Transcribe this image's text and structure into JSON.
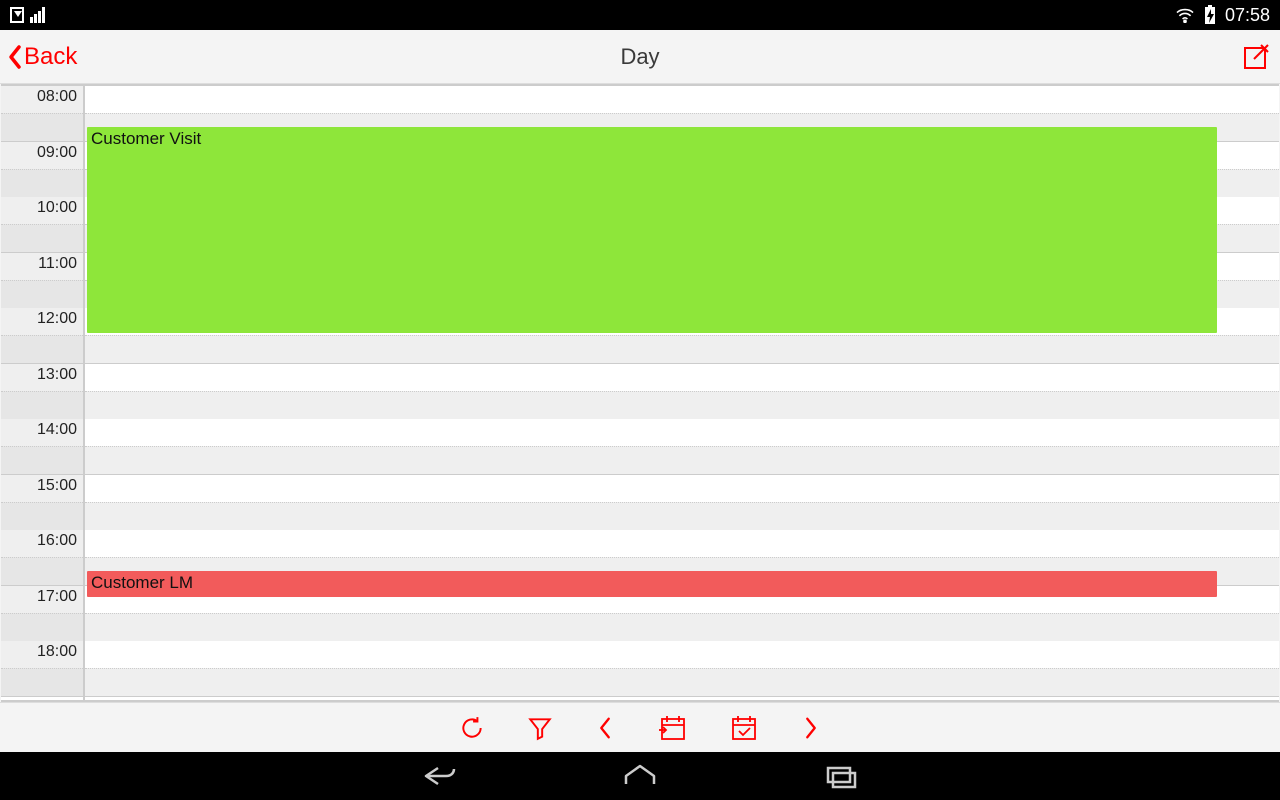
{
  "status": {
    "time": "07:58"
  },
  "header": {
    "back_label": "Back",
    "title": "Day"
  },
  "hours": [
    "08:00",
    "09:00",
    "10:00",
    "11:00",
    "12:00",
    "13:00",
    "14:00",
    "15:00",
    "16:00",
    "17:00",
    "18:00"
  ],
  "events": [
    {
      "title": "Customer Visit",
      "start_hour": 8.5,
      "end_hour": 12.25,
      "color": "green"
    },
    {
      "title": "Customer LM",
      "start_hour": 16.5,
      "end_hour": 17.0,
      "color": "red"
    }
  ],
  "colors": {
    "accent": "#ff0000",
    "event_green": "#8ee63a",
    "event_red": "#f25b5b"
  },
  "toolbar_icons": [
    "refresh",
    "filter",
    "prev",
    "calendar-go",
    "calendar-today",
    "next"
  ]
}
